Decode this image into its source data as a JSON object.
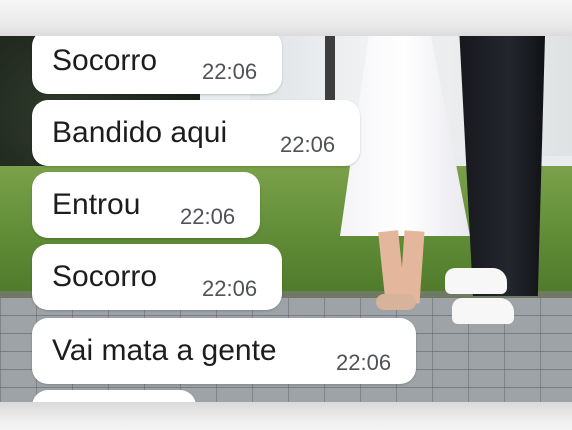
{
  "messages": [
    {
      "text": "Socorro",
      "time": "22:06"
    },
    {
      "text": "Bandido aqui",
      "time": "22:06"
    },
    {
      "text": "Entrou",
      "time": "22:06"
    },
    {
      "text": "Socorro",
      "time": "22:06"
    },
    {
      "text": "Vai mata a gente",
      "time": "22:06"
    },
    {
      "text": "",
      "time": ""
    }
  ],
  "colors": {
    "bubble": "#ffffff",
    "message_text": "#1d1d1d",
    "timestamp_text": "#505256"
  }
}
